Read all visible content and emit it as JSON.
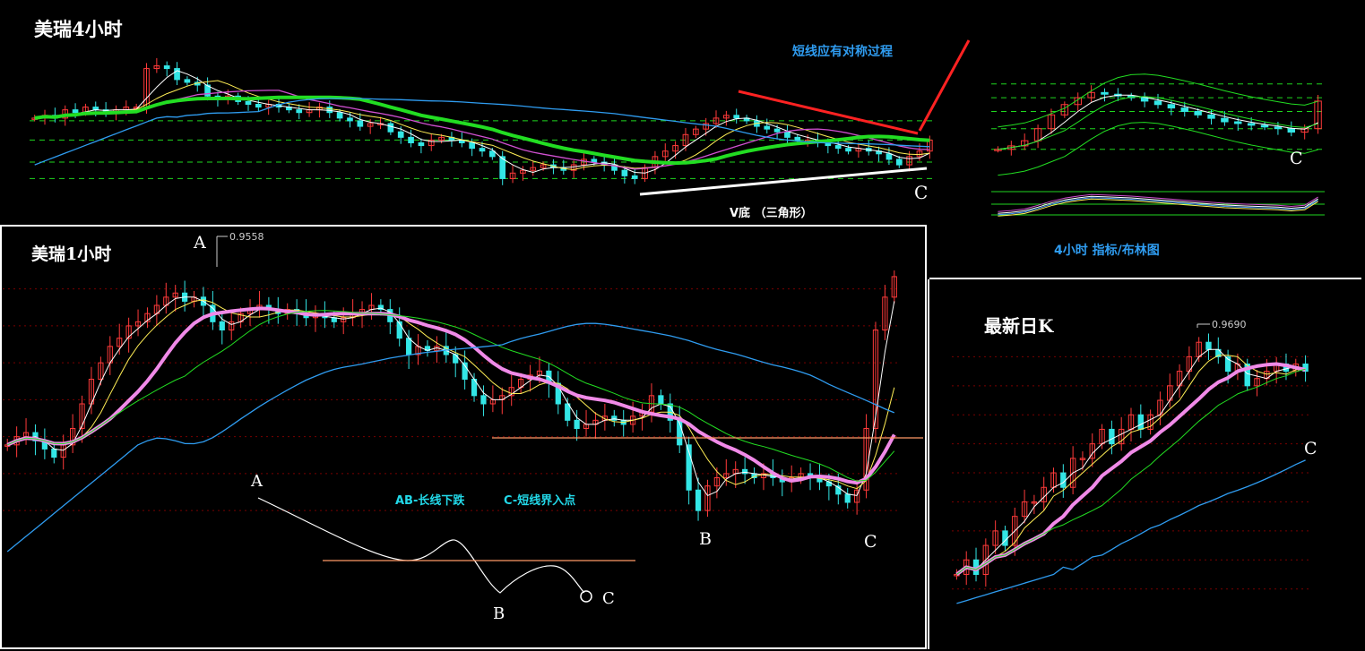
{
  "colors": {
    "background": "#000000",
    "up": "#ff3a3a",
    "down": "#33e6e6",
    "ma_green": "#22dd22",
    "ma_pink": "#f08ae8",
    "ma_blue": "#2f9cf0",
    "annotation_blue": "#2f9cf0",
    "annotation_cyan": "#22d8e8",
    "white": "#ffffff",
    "red_line": "#ff2222",
    "orange_line": "#ff9966",
    "grid_red": "#7a0000",
    "grid_green": "#1fd61f"
  },
  "panel_4h": {
    "title": "美瑞4小时",
    "note": "短线应有对称过程",
    "caption": "V底 （三角形）",
    "point_c": "C"
  },
  "panel_1h": {
    "title": "美瑞1小时",
    "point_a": "A",
    "high_label": "0.9558",
    "point_b": "B",
    "point_c": "C",
    "sketch": {
      "a": "A",
      "b": "B",
      "c": "C",
      "caption_ab": "AB-长线下跌",
      "caption_c": "C-短线界入点"
    }
  },
  "panel_4h_indicator": {
    "point_c": "C",
    "caption": "4小时 指标/布林图"
  },
  "panel_daily": {
    "title": "最新日K",
    "high_label": "0.9690",
    "point_c": "C"
  },
  "chart_data": [
    {
      "type": "line",
      "name": "4h candlestick",
      "title": "美瑞4小时",
      "annotations": [
        "短线应有对称过程",
        "V底 （三角形）",
        "C"
      ],
      "series": [
        {
          "values": [
            0.52,
            0.53,
            0.52,
            0.55,
            0.54,
            0.56,
            0.55,
            0.54,
            0.55,
            0.56,
            0.56,
            0.7,
            0.71,
            0.7,
            0.66,
            0.65,
            0.64,
            0.6,
            0.59,
            0.6,
            0.58,
            0.57,
            0.56,
            0.57,
            0.56,
            0.55,
            0.54,
            0.55,
            0.56,
            0.54,
            0.52,
            0.51,
            0.49,
            0.5,
            0.5,
            0.47,
            0.45,
            0.43,
            0.42,
            0.44,
            0.45,
            0.44,
            0.43,
            0.41,
            0.4,
            0.38,
            0.3,
            0.32,
            0.33,
            0.34,
            0.35,
            0.34,
            0.33,
            0.35,
            0.37,
            0.36,
            0.35,
            0.33,
            0.31,
            0.3,
            0.34,
            0.38,
            0.4,
            0.42,
            0.46,
            0.48,
            0.5,
            0.52,
            0.53,
            0.52,
            0.51,
            0.49,
            0.48,
            0.47,
            0.45,
            0.44,
            0.44,
            0.43,
            0.42,
            0.41,
            0.4,
            0.41,
            0.4,
            0.39,
            0.37,
            0.35,
            0.38,
            0.4,
            0.44
          ]
        }
      ]
    },
    {
      "type": "line",
      "name": "1h candlestick",
      "title": "美瑞1小时",
      "annotations": [
        "A",
        "0.9558",
        "B",
        "C"
      ],
      "series": [
        {
          "values": [
            0.56,
            0.58,
            0.59,
            0.57,
            0.55,
            0.53,
            0.56,
            0.6,
            0.66,
            0.72,
            0.76,
            0.8,
            0.82,
            0.85,
            0.86,
            0.88,
            0.9,
            0.92,
            0.93,
            0.91,
            0.92,
            0.9,
            0.86,
            0.84,
            0.86,
            0.88,
            0.89,
            0.9,
            0.89,
            0.88,
            0.89,
            0.88,
            0.87,
            0.88,
            0.87,
            0.86,
            0.87,
            0.88,
            0.89,
            0.9,
            0.89,
            0.86,
            0.82,
            0.78,
            0.8,
            0.79,
            0.8,
            0.78,
            0.76,
            0.72,
            0.68,
            0.66,
            0.67,
            0.68,
            0.7,
            0.72,
            0.73,
            0.74,
            0.71,
            0.66,
            0.62,
            0.6,
            0.61,
            0.62,
            0.63,
            0.62,
            0.61,
            0.63,
            0.64,
            0.68,
            0.66,
            0.62,
            0.56,
            0.45,
            0.4,
            0.46,
            0.48,
            0.49,
            0.5,
            0.49,
            0.48,
            0.49,
            0.48,
            0.47,
            0.48,
            0.49,
            0.48,
            0.47,
            0.46,
            0.44,
            0.42,
            0.45,
            0.6,
            0.84,
            0.92,
            0.97
          ]
        }
      ]
    },
    {
      "type": "line",
      "name": "4h indicator / Bollinger",
      "annotations": [
        "C",
        "4小时 指标/布林图"
      ],
      "series": [
        {
          "values": [
            0.4,
            0.42,
            0.45,
            0.52,
            0.6,
            0.66,
            0.7,
            0.73,
            0.72,
            0.71,
            0.7,
            0.68,
            0.66,
            0.64,
            0.62,
            0.6,
            0.58,
            0.56,
            0.55,
            0.54,
            0.53,
            0.52,
            0.5,
            0.52,
            0.68
          ]
        }
      ]
    },
    {
      "type": "line",
      "name": "daily candlestick",
      "title": "最新日K",
      "annotations": [
        "0.9690",
        "C"
      ],
      "series": [
        {
          "values": [
            0.8,
            0.81,
            0.8,
            0.82,
            0.83,
            0.82,
            0.84,
            0.85,
            0.85,
            0.86,
            0.87,
            0.86,
            0.88,
            0.88,
            0.89,
            0.9,
            0.89,
            0.9,
            0.91,
            0.9,
            0.91,
            0.92,
            0.93,
            0.94,
            0.95,
            0.96,
            0.955,
            0.95,
            0.94,
            0.945,
            0.93,
            0.935,
            0.94,
            0.945,
            0.94,
            0.945,
            0.94
          ]
        }
      ]
    }
  ]
}
